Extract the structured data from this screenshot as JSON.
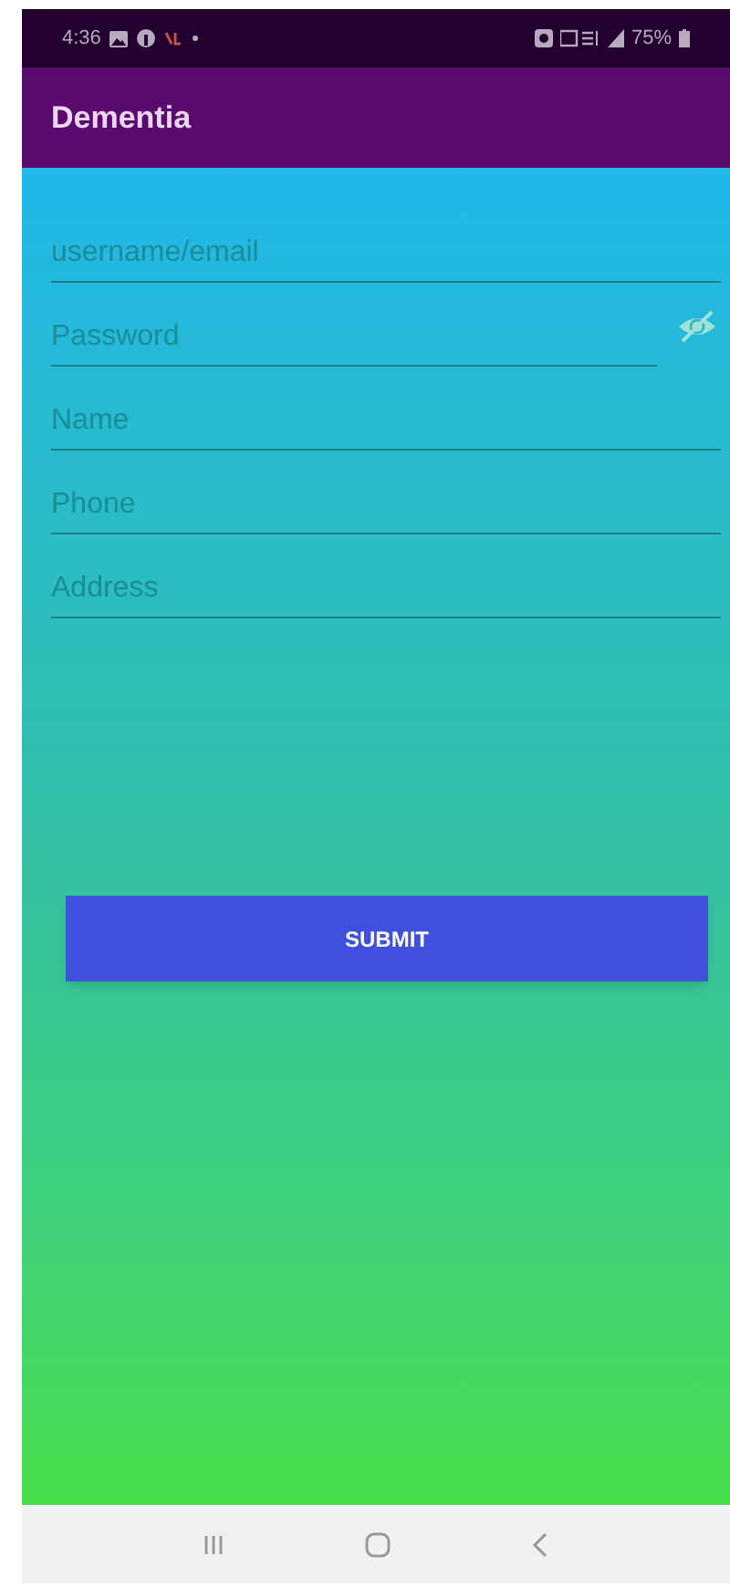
{
  "status_bar": {
    "time": "4:36",
    "battery": "75%"
  },
  "app_bar": {
    "title": "Dementia"
  },
  "fields": [
    {
      "placeholder": "username/email",
      "kind": "text"
    },
    {
      "placeholder": "Password",
      "kind": "password"
    },
    {
      "placeholder": "Name",
      "kind": "text"
    },
    {
      "placeholder": "Phone",
      "kind": "text"
    },
    {
      "placeholder": "Address",
      "kind": "text"
    }
  ],
  "submit_button": {
    "label": "SUBMIT"
  }
}
